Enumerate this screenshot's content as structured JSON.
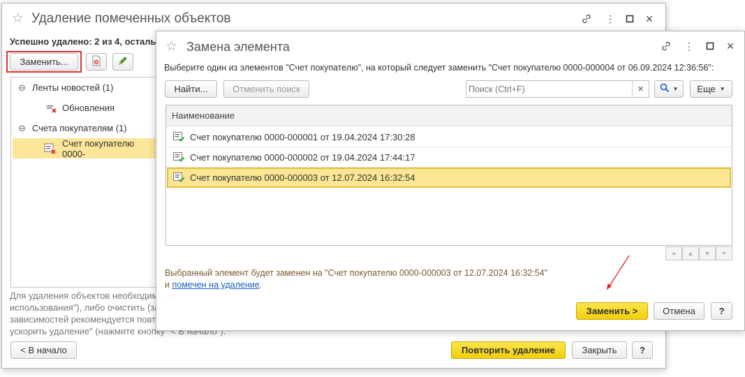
{
  "back_window": {
    "title": "Удаление помеченных объектов",
    "status": "Успешно удалено: 2 из 4, осталь",
    "replace_button": "Заменить...",
    "tree": [
      {
        "label": "Ленты новостей (1)",
        "expand": "⊖"
      },
      {
        "label": "Обновления"
      },
      {
        "label": "Счета покупателям (1)",
        "expand": "⊖"
      },
      {
        "label": "Счет покупателю 0000-"
      }
    ],
    "info_lines": [
      "Для удаления объектов необходим",
      "использования\"), либо очистить (за",
      "зависимостей рекомендуется повт",
      "ускорить удаление\" (нажмите кнопку \"< В начало\")."
    ],
    "back_button": "< В начало",
    "retry_button": "Повторить удаление",
    "close_button": "Закрыть",
    "help_button": "?"
  },
  "dialog": {
    "title": "Замена элемента",
    "instruction": "Выберите один из элементов \"Счет покупателю\", на который следует заменить \"Счет покупателю 0000-000004 от 06.09.2024 12:36:56\":",
    "find_button": "Найти...",
    "cancel_search_button": "Отменить поиск",
    "search_placeholder": "Поиск (Ctrl+F)",
    "search_clear": "×",
    "more_button": "Еще",
    "column_header": "Наименование",
    "rows": [
      {
        "text": "Счет покупателю 0000-000001 от 19.04.2024 17:30:28",
        "selected": false
      },
      {
        "text": "Счет покупателю 0000-000002 от 19.04.2024 17:44:17",
        "selected": false
      },
      {
        "text": "Счет покупателю 0000-000003 от 12.07.2024 16:32:54",
        "selected": true
      }
    ],
    "result_line1": "Выбранный элемент будет заменен на \"Счет покупателю 0000-000003 от 12.07.2024 16:32:54\"",
    "result_line2_prefix": "и",
    "result_line2_link": "помечен на удаление",
    "result_line2_suffix": ".",
    "replace_button": "Заменить >",
    "cancel_button": "Отмена",
    "help_button": "?"
  }
}
